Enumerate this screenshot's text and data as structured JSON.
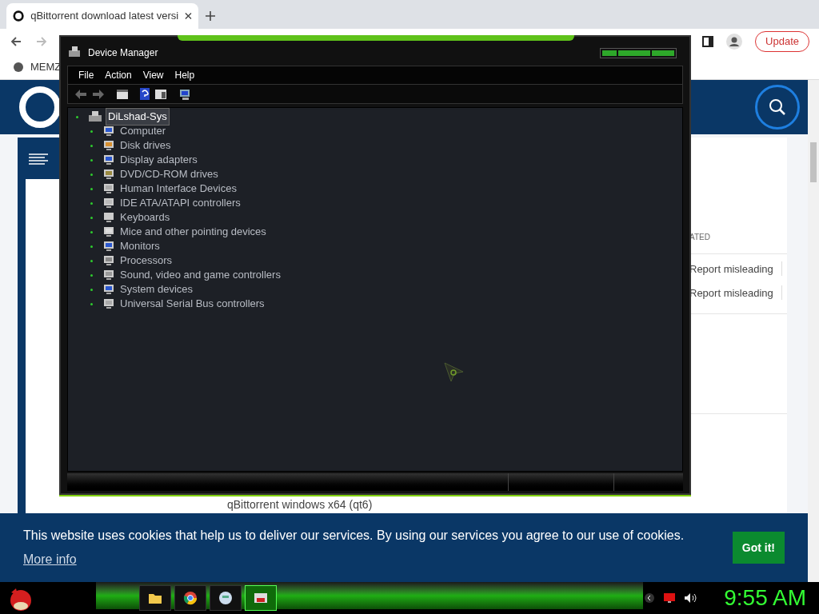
{
  "browser": {
    "tab_title": "qBittorrent download latest versi",
    "update_button": "Update",
    "bookmark": "MEMZ"
  },
  "web_page": {
    "column_header": "ATED",
    "report_links": [
      "Report misleading",
      "Report misleading"
    ],
    "download_name": "qBittorrent windows x64 (qt6)"
  },
  "cookie_banner": {
    "text": "This website uses cookies that help us to deliver our services. By using our services you agree to our use of cookies.",
    "more_info": "More info",
    "button": "Got it!"
  },
  "device_manager": {
    "title": "Device Manager",
    "menu": [
      "File",
      "Action",
      "View",
      "Help"
    ],
    "tree": {
      "label": "DiLshad-Sys",
      "selected": true,
      "children": [
        {
          "label": "Computer",
          "selected": false
        },
        {
          "label": "Disk drives",
          "selected": false
        },
        {
          "label": "Display adapters",
          "selected": false
        },
        {
          "label": "DVD/CD-ROM drives",
          "selected": false
        },
        {
          "label": "Human Interface Devices",
          "selected": false
        },
        {
          "label": "IDE ATA/ATAPI controllers",
          "selected": false
        },
        {
          "label": "Keyboards",
          "selected": false
        },
        {
          "label": "Mice and other pointing devices",
          "selected": false
        },
        {
          "label": "Monitors",
          "selected": false
        },
        {
          "label": "Processors",
          "selected": false
        },
        {
          "label": "Sound, video and game controllers",
          "selected": false
        },
        {
          "label": "System devices",
          "selected": false
        },
        {
          "label": "Universal Serial Bus controllers",
          "selected": false
        }
      ]
    }
  },
  "taskbar": {
    "apps": [
      {
        "kind": "folder",
        "selected": false
      },
      {
        "kind": "browser",
        "selected": false
      },
      {
        "kind": "globe",
        "selected": false
      },
      {
        "kind": "device-manager",
        "selected": true
      }
    ],
    "clock": "9:55 AM"
  }
}
